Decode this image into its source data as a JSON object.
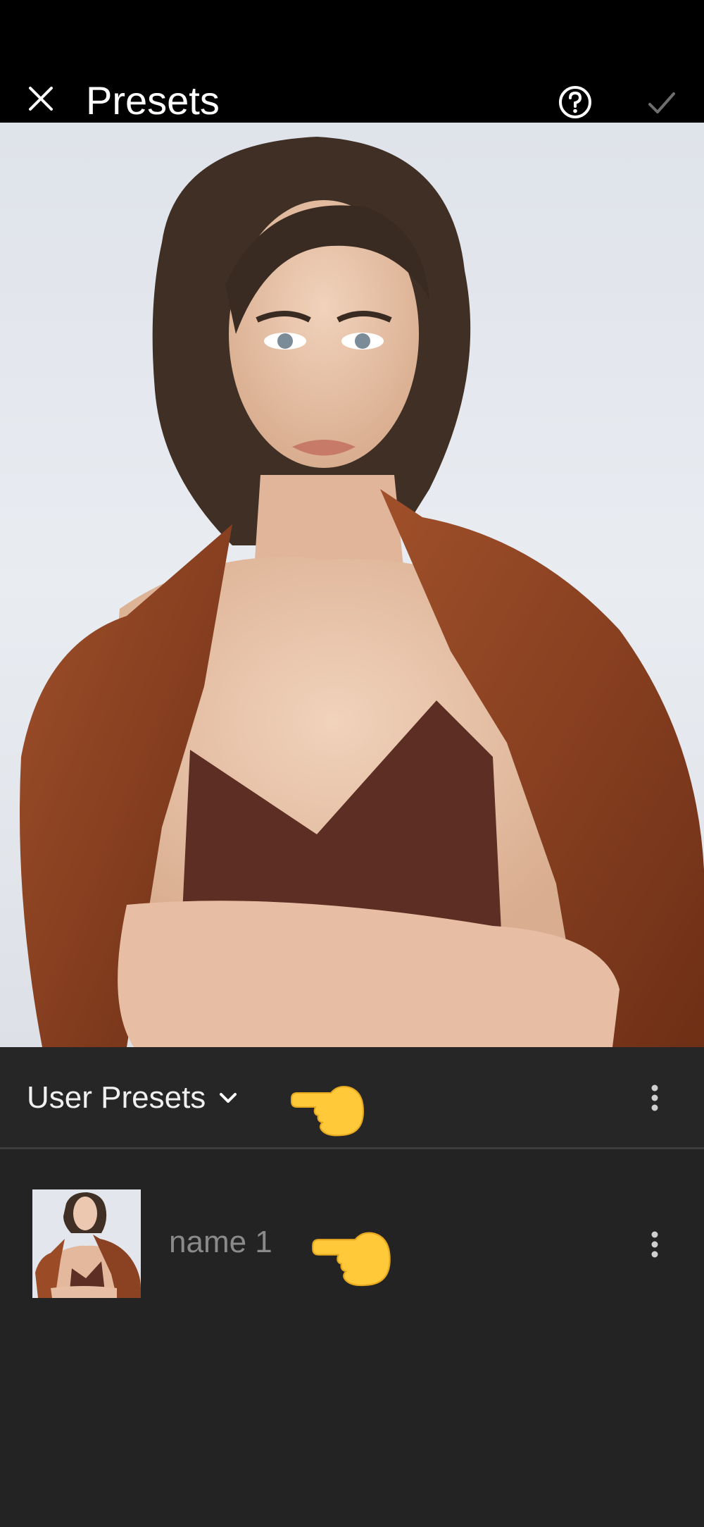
{
  "header": {
    "title": "Presets",
    "close_icon": "close-icon",
    "help_icon": "help-circle-icon",
    "confirm_icon": "checkmark-icon"
  },
  "photo": {
    "description_icon": "portrait-photo"
  },
  "presets_panel": {
    "group_label": "User Presets",
    "dropdown_icon": "chevron-down-icon",
    "more_icon": "more-vertical-icon",
    "items": [
      {
        "name": "name 1",
        "more_icon": "more-vertical-icon"
      }
    ]
  },
  "overlays": {
    "pointer_icon": "pointing-hand-icon",
    "pointer_color": "#FFC93A"
  },
  "colors": {
    "app_bg": "#232323",
    "topbar_bg": "#000000",
    "panel_bg": "#262626",
    "text_primary": "#FFFFFF",
    "text_muted": "#8A8A8A"
  }
}
